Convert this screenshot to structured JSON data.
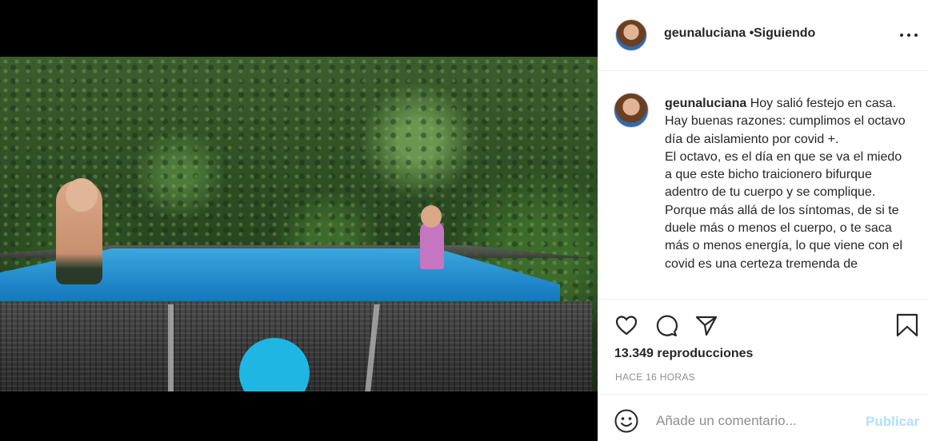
{
  "post": {
    "username": "geunaluciana",
    "separator": "•",
    "follow_label": "Siguiendo",
    "caption_lines": [
      "Hoy salió festejo en casa.",
      "Hay buenas razones: cumplimos el octavo día de aislamiento por covid +.",
      "El octavo, es el día en que se va el miedo a que este bicho traicionero bifurque adentro de tu cuerpo y se complique. Porque más allá de los síntomas, de si te duele más o menos el cuerpo, o te saca más o menos energía, lo que viene con el covid es una certeza tremenda de"
    ],
    "views": "13.349 reproducciones",
    "time_ago": "HACE 16 HORAS"
  },
  "comment": {
    "placeholder": "Añade un comentario...",
    "post_label": "Publicar"
  },
  "colors": {
    "text": "#262626",
    "muted": "#8e8e8e",
    "publish_disabled": "#b2dffc",
    "pool_blue": "#1fb6e3"
  },
  "icons": [
    "muted-audio-icon",
    "more-options-icon",
    "heart-icon",
    "comment-icon",
    "share-icon",
    "bookmark-icon",
    "emoji-icon"
  ]
}
